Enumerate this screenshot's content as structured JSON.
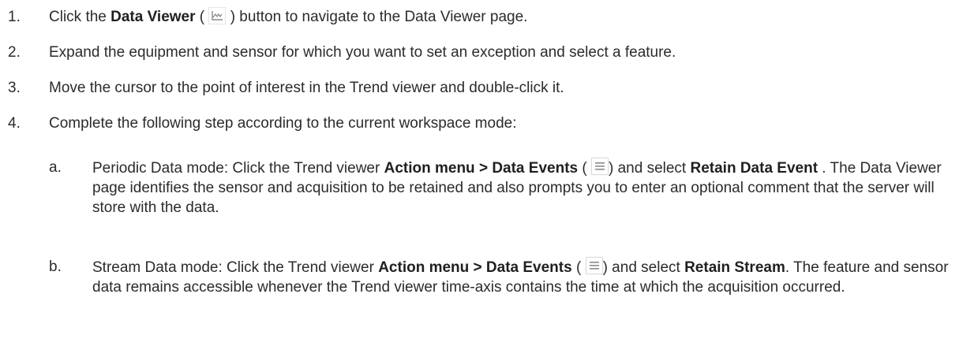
{
  "steps": [
    {
      "number": "1.",
      "pre": "Click the ",
      "bold1": "Data Viewer",
      "mid": " (",
      "icon": "data-viewer-icon",
      "post": " ) button to navigate to the Data Viewer page."
    },
    {
      "number": "2.",
      "text": "Expand the equipment and sensor for which you want to set an exception and select a feature."
    },
    {
      "number": "3.",
      "text": "Move the cursor to the point of interest in the Trend viewer and double-click it."
    },
    {
      "number": "4.",
      "text": "Complete the following step according to the current workspace mode:"
    }
  ],
  "substeps": [
    {
      "letter": "a.",
      "pre": "Periodic Data mode: Click the Trend viewer ",
      "bold1": "Action menu > Data Events",
      "mid": " (",
      "icon": "menu-lines-icon",
      "mid2": ") and select ",
      "bold2": "Retain Data Event",
      "post": " . The Data Viewer page identifies the sensor and acquisition to be retained and also prompts you to enter an optional comment that the server will store with the data."
    },
    {
      "letter": "b.",
      "pre": "Stream Data mode: Click the Trend viewer ",
      "bold1": "Action menu > Data Events",
      "mid": " (",
      "icon": "menu-lines-icon",
      "mid2": ") and select ",
      "bold2": "Retain Stream",
      "post": ". The feature and sensor data remains accessible whenever the Trend viewer time-axis contains the time at which the acquisition occurred."
    }
  ],
  "colors": {
    "text": "#2b2b2b",
    "icon_gray": "#8a8a8a"
  }
}
